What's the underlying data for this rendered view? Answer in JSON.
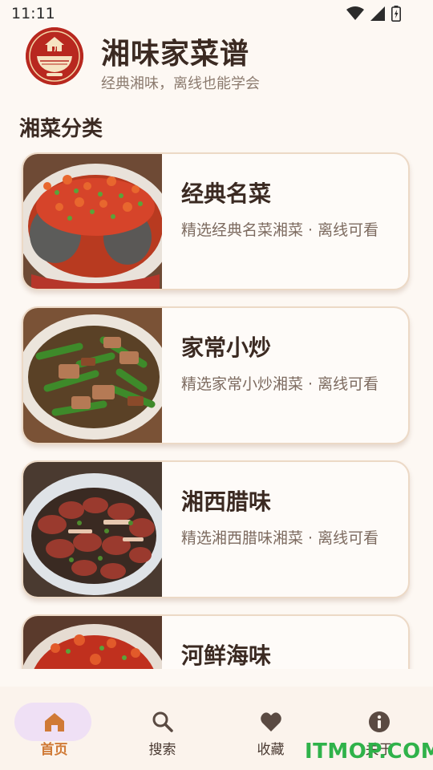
{
  "status_bar": {
    "time": "11:11"
  },
  "header": {
    "title": "湘味家菜谱",
    "subtitle": "经典湘味，离线也能学会"
  },
  "section": {
    "title": "湘菜分类"
  },
  "categories": [
    {
      "title": "经典名菜",
      "desc": "精选经典名菜湘菜 · 离线可看"
    },
    {
      "title": "家常小炒",
      "desc": "精选家常小炒湘菜 · 离线可看"
    },
    {
      "title": "湘西腊味",
      "desc": "精选湘西腊味湘菜 · 离线可看"
    },
    {
      "title": "河鲜海味",
      "desc": ""
    }
  ],
  "nav": [
    {
      "label": "首页",
      "icon": "home-icon",
      "active": true
    },
    {
      "label": "搜索",
      "icon": "search-icon",
      "active": false
    },
    {
      "label": "收藏",
      "icon": "heart-icon",
      "active": false
    },
    {
      "label": "关于",
      "icon": "info-icon",
      "active": false
    }
  ],
  "watermark": "ITMOP.COM",
  "colors": {
    "accent": "#d07a36",
    "background": "#fdf8f3",
    "nav_pill": "#efe0f5"
  }
}
